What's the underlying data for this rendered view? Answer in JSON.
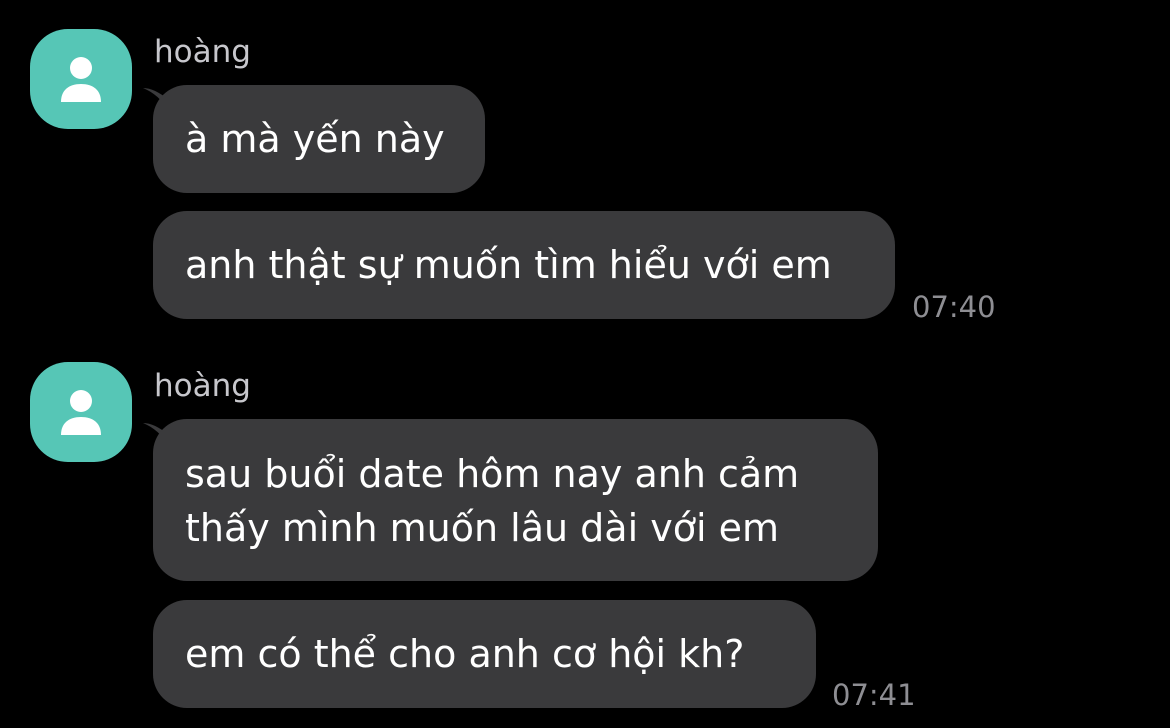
{
  "messages": [
    {
      "sender": "hoàng",
      "bubbles": [
        "à mà yến này",
        "anh thật sự muốn tìm hiểu với em"
      ],
      "time": "07:40"
    },
    {
      "sender": "hoàng",
      "bubbles": [
        "sau buổi date hôm nay anh cảm",
        "thấy mình muốn lâu dài với em",
        "em có thể cho anh cơ hội kh?"
      ],
      "time": "07:41"
    }
  ],
  "colors": {
    "background": "#000000",
    "bubble": "#3a3a3c",
    "avatar": "#56c6b6",
    "sender_text": "#c7c7cc",
    "time_text": "#8e8e93"
  },
  "icons": {
    "avatar": "person-icon"
  }
}
